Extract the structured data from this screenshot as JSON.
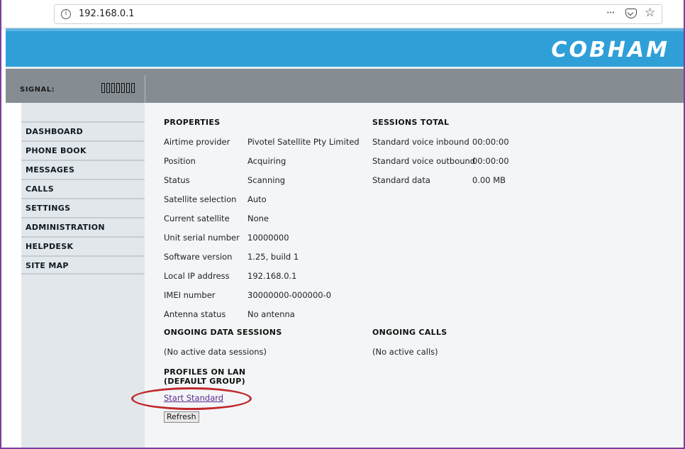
{
  "browser": {
    "url": "192.168.0.1",
    "info_icon": "info-icon",
    "more_icon": "···",
    "pocket_icon": "pocket-icon",
    "star_icon": "☆"
  },
  "header": {
    "logo": "COBHAM",
    "brand_color": "#2f9fd8"
  },
  "signal": {
    "label": "SIGNAL:",
    "bar_count": 7,
    "level": 0
  },
  "nav": {
    "items": [
      {
        "label": "DASHBOARD"
      },
      {
        "label": "PHONE BOOK"
      },
      {
        "label": "MESSAGES"
      },
      {
        "label": "CALLS"
      },
      {
        "label": "SETTINGS"
      },
      {
        "label": "ADMINISTRATION"
      },
      {
        "label": "HELPDESK"
      },
      {
        "label": "SITE MAP"
      }
    ]
  },
  "properties": {
    "heading": "PROPERTIES",
    "rows": [
      {
        "label": "Airtime provider",
        "value": "Pivotel Satellite Pty Limited"
      },
      {
        "label": "Position",
        "value": "Acquiring"
      },
      {
        "label": "Status",
        "value": "Scanning"
      },
      {
        "label": "Satellite selection",
        "value": "Auto"
      },
      {
        "label": "Current satellite",
        "value": "None"
      },
      {
        "label": "Unit serial number",
        "value": "10000000"
      },
      {
        "label": "Software version",
        "value": "1.25, build 1"
      },
      {
        "label": "Local IP address",
        "value": "192.168.0.1"
      },
      {
        "label": "IMEI number",
        "value": "30000000-000000-0"
      },
      {
        "label": "Antenna status",
        "value": "No antenna"
      }
    ]
  },
  "sessions": {
    "heading": "SESSIONS TOTAL",
    "rows": [
      {
        "label": "Standard voice inbound",
        "value": "00:00:00"
      },
      {
        "label": "Standard voice outbound",
        "value": "00:00:00"
      },
      {
        "label": "Standard data",
        "value": "0.00 MB"
      }
    ]
  },
  "data_sessions": {
    "heading": "ONGOING DATA SESSIONS",
    "text": "(No active data sessions)"
  },
  "calls": {
    "heading": "ONGOING CALLS",
    "text": "(No active calls)"
  },
  "profiles": {
    "heading_line1": "PROFILES ON LAN",
    "heading_line2": "(DEFAULT GROUP)",
    "link": "Start Standard",
    "refresh": "Refresh"
  },
  "annotation_color": "#c0272d"
}
